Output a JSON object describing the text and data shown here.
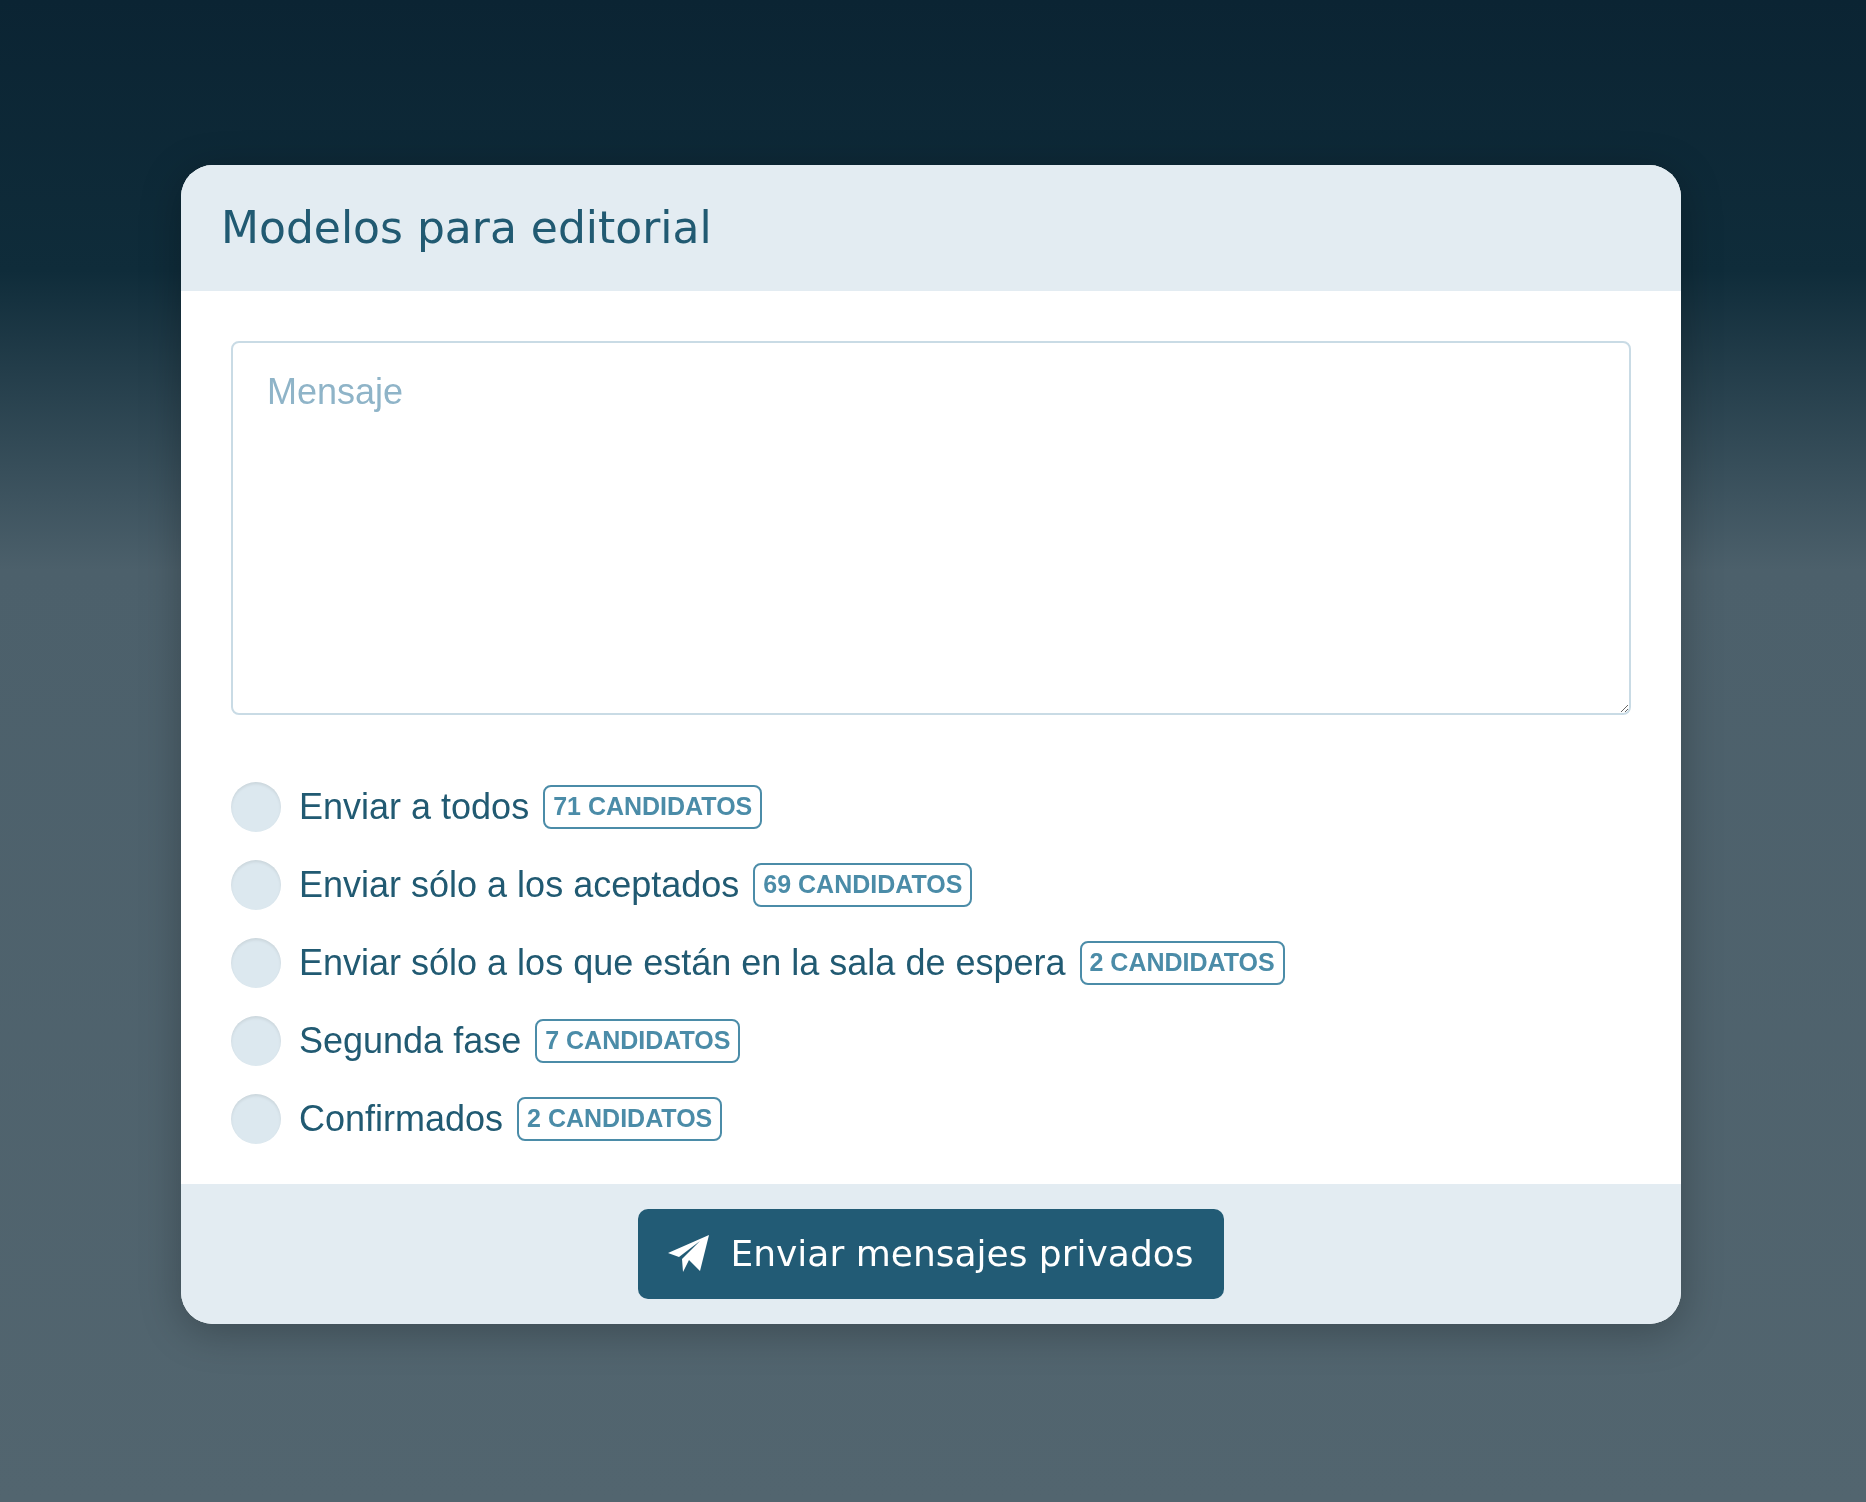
{
  "card": {
    "title": "Modelos para editorial"
  },
  "message": {
    "placeholder": "Mensaje"
  },
  "options": [
    {
      "label": "Enviar a todos",
      "count": "71 CANDIDATOS",
      "selected": false
    },
    {
      "label": "Enviar sólo a los aceptados",
      "count": "69 CANDIDATOS",
      "selected": false
    },
    {
      "label": "Enviar sólo a los que están en la sala de espera",
      "count": "2 CANDIDATOS",
      "selected": false
    },
    {
      "label": "Segunda fase",
      "count": "7 CANDIDATOS",
      "selected": false
    },
    {
      "label": "Confirmados",
      "count": "2 CANDIDATOS",
      "selected": false
    }
  ],
  "submit": {
    "label": "Enviar mensajes privados"
  }
}
